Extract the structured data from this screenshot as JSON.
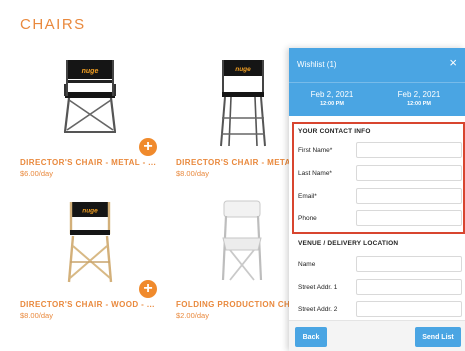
{
  "page": {
    "title": "CHAIRS"
  },
  "products": [
    {
      "name": "DIRECTOR'S CHAIR - METAL - ...",
      "price": "$6.00/day",
      "logo": "nuge",
      "add_icon": "plus-icon"
    },
    {
      "name": "DIRECTOR'S CHAIR - METAL",
      "price": "$8.00/day",
      "logo": "nuge"
    },
    {
      "name": "DIRECTOR'S CHAIR - WOOD - ...",
      "price": "$8.00/day",
      "logo": "nuge",
      "add_icon": "plus-icon"
    },
    {
      "name": "FOLDING PRODUCTION CHAIR",
      "price": "$2.00/day"
    }
  ],
  "wishlist": {
    "title": "Wishlist (1)",
    "close_icon": "close-icon",
    "start": {
      "date": "Feb 2, 2021",
      "time": "12:00 PM"
    },
    "end": {
      "date": "Feb 2, 2021",
      "time": "12:00 PM"
    },
    "contact": {
      "title": "YOUR CONTACT INFO",
      "first_name_label": "First Name*",
      "last_name_label": "Last Name*",
      "email_label": "Email*",
      "phone_label": "Phone"
    },
    "venue": {
      "title": "VENUE / DELIVERY LOCATION",
      "name_label": "Name",
      "street1_label": "Street Addr. 1",
      "street2_label": "Street Addr. 2"
    },
    "back_label": "Back",
    "send_label": "Send List"
  },
  "colors": {
    "accent": "#e9893d",
    "add_button": "#f08a2c",
    "panel_blue": "#4aa5e3",
    "highlight": "#d8452f"
  }
}
